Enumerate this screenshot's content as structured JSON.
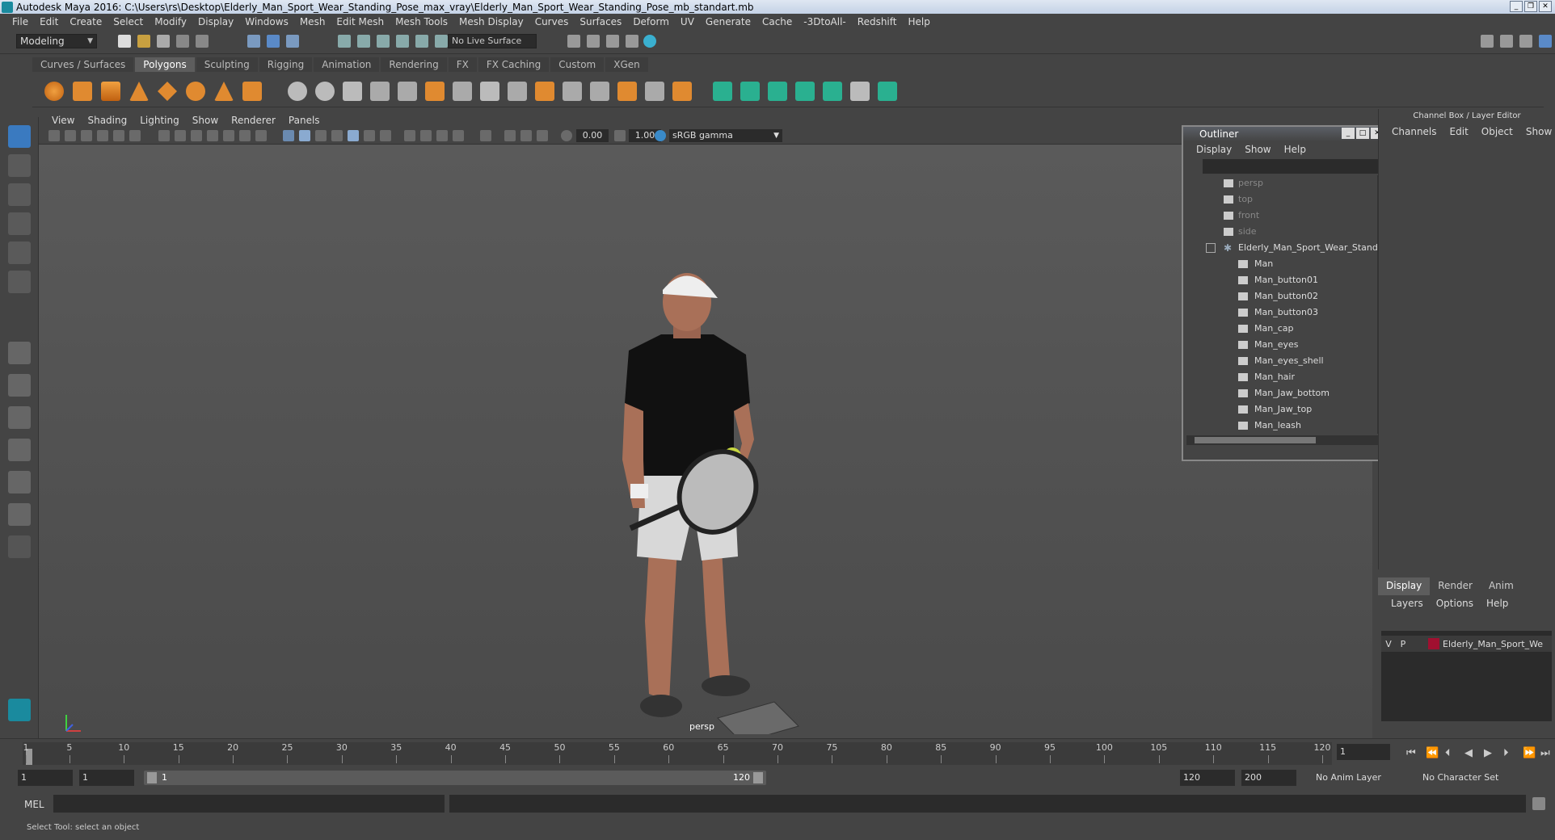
{
  "window": {
    "title": "Autodesk Maya 2016: C:\\Users\\rs\\Desktop\\Elderly_Man_Sport_Wear_Standing_Pose_max_vray\\Elderly_Man_Sport_Wear_Standing_Pose_mb_standart.mb",
    "controls": [
      "_",
      "❐",
      "✕"
    ]
  },
  "menubar": [
    "File",
    "Edit",
    "Create",
    "Select",
    "Modify",
    "Display",
    "Windows",
    "Mesh",
    "Edit Mesh",
    "Mesh Tools",
    "Mesh Display",
    "Curves",
    "Surfaces",
    "Deform",
    "UV",
    "Generate",
    "Cache",
    "-3DtoAll-",
    "Redshift",
    "Help"
  ],
  "statusline": {
    "mode": "Modeling",
    "live_surface": "No Live Surface"
  },
  "shelf": {
    "tabs": [
      "Curves / Surfaces",
      "Polygons",
      "Sculpting",
      "Rigging",
      "Animation",
      "Rendering",
      "FX",
      "FX Caching",
      "Custom",
      "XGen"
    ],
    "active_tab": "Polygons"
  },
  "panel": {
    "menus": [
      "View",
      "Shading",
      "Lighting",
      "Show",
      "Renderer",
      "Panels"
    ],
    "exposure": "0.00",
    "gamma_value": "1.00",
    "color_space": "sRGB gamma",
    "camera_label": "persp"
  },
  "outliner": {
    "title": "Outliner",
    "menus": [
      "Display",
      "Show",
      "Help"
    ],
    "items": [
      {
        "label": "persp",
        "type": "camera",
        "dim": true
      },
      {
        "label": "top",
        "type": "camera",
        "dim": true
      },
      {
        "label": "front",
        "type": "camera",
        "dim": true
      },
      {
        "label": "side",
        "type": "camera",
        "dim": true
      },
      {
        "label": "Elderly_Man_Sport_Wear_Standin",
        "type": "group",
        "dim": false
      },
      {
        "label": "Man",
        "type": "mesh",
        "dim": false
      },
      {
        "label": "Man_button01",
        "type": "mesh",
        "dim": false
      },
      {
        "label": "Man_button02",
        "type": "mesh",
        "dim": false
      },
      {
        "label": "Man_button03",
        "type": "mesh",
        "dim": false
      },
      {
        "label": "Man_cap",
        "type": "mesh",
        "dim": false
      },
      {
        "label": "Man_eyes",
        "type": "mesh",
        "dim": false
      },
      {
        "label": "Man_eyes_shell",
        "type": "mesh",
        "dim": false
      },
      {
        "label": "Man_hair",
        "type": "mesh",
        "dim": false
      },
      {
        "label": "Man_Jaw_bottom",
        "type": "mesh",
        "dim": false
      },
      {
        "label": "Man_Jaw_top",
        "type": "mesh",
        "dim": false
      },
      {
        "label": "Man_leash",
        "type": "mesh",
        "dim": false
      }
    ]
  },
  "channelbox": {
    "title": "Channel Box / Layer Editor",
    "menus": [
      "Channels",
      "Edit",
      "Object",
      "Show"
    ]
  },
  "layereditor": {
    "tabs": [
      "Display",
      "Render",
      "Anim"
    ],
    "active_tab": "Display",
    "menus": [
      "Layers",
      "Options",
      "Help"
    ],
    "layer": {
      "v": "V",
      "p": "P",
      "name": "Elderly_Man_Sport_We",
      "color": "#a01030"
    }
  },
  "timeslider": {
    "ticks": [
      "1",
      "5",
      "10",
      "15",
      "20",
      "25",
      "30",
      "35",
      "40",
      "45",
      "50",
      "55",
      "60",
      "65",
      "70",
      "75",
      "80",
      "85",
      "90",
      "95",
      "100",
      "105",
      "110",
      "115",
      "120"
    ],
    "current_frame": "1"
  },
  "rangeslider": {
    "start": "1",
    "current": "1",
    "bar_start": "1",
    "bar_end": "120",
    "end": "120",
    "max": "200",
    "anim_layer": "No Anim Layer",
    "char_set": "No Character Set"
  },
  "cmdline": {
    "label": "MEL"
  },
  "helpline": {
    "text": "Select Tool: select an object"
  }
}
